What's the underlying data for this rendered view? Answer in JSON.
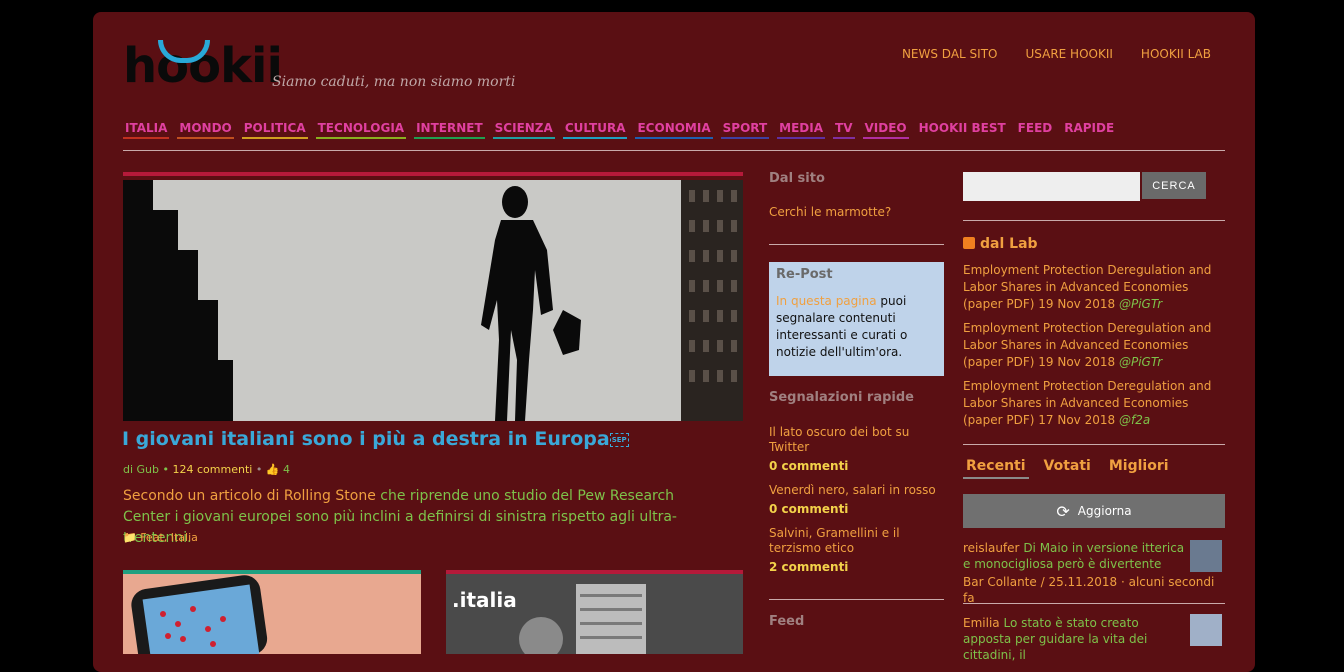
{
  "header": {
    "logo": "hookii",
    "tagline": "Siamo caduti, ma non siamo morti",
    "topnav": [
      "NEWS DAL SITO",
      "USARE HOOKII",
      "HOOKII LAB"
    ]
  },
  "categories": [
    {
      "label": "ITALIA",
      "color": "#e040a0",
      "line": "#c03020"
    },
    {
      "label": "MONDO",
      "color": "#e040a0",
      "line": "#c05020"
    },
    {
      "label": "POLITICA",
      "color": "#e040a0",
      "line": "#d0a020"
    },
    {
      "label": "TECNOLOGIA",
      "color": "#e040a0",
      "line": "#8ab020"
    },
    {
      "label": "INTERNET",
      "color": "#e040a0",
      "line": "#20a050"
    },
    {
      "label": "SCIENZA",
      "color": "#e040a0",
      "line": "#20a0a0"
    },
    {
      "label": "CULTURA",
      "color": "#e040a0",
      "line": "#20a0c0"
    },
    {
      "label": "ECONOMIA",
      "color": "#e040a0",
      "line": "#2060b0"
    },
    {
      "label": "SPORT",
      "color": "#e040a0",
      "line": "#4040a0"
    },
    {
      "label": "MEDIA",
      "color": "#e040a0",
      "line": "#6030a0"
    },
    {
      "label": "TV",
      "color": "#e040a0",
      "line": "#8030a0"
    },
    {
      "label": "VIDEO",
      "color": "#e040a0",
      "line": "#b030a0"
    },
    {
      "label": "HOOKII BEST",
      "color": "#e040a0",
      "line": "#5a0f13"
    },
    {
      "label": "FEED",
      "color": "#e040a0",
      "line": "#5a0f13"
    },
    {
      "label": "RAPIDE",
      "color": "#e040a0",
      "line": "#5a0f13"
    }
  ],
  "hero": {
    "title": "I giovani italiani sono i più a destra in Europa",
    "sep": "SEP",
    "byline_prefix": "di Gub •",
    "comments": "124 commenti",
    "likes": "4",
    "excerpt_link": "Secondo un articolo di Rolling Stone",
    "excerpt_rest": "che riprende uno studio del Pew Research Center i giovani europei sono più inclini a definirsi di sinistra rispetto agli ultra-trentenni.",
    "tags": "Feat, Italia"
  },
  "cards": [
    {
      "bar_color": "#20a080"
    },
    {
      "bar_color": "#b51a3a",
      "label": ".italia"
    }
  ],
  "mid": {
    "dal_sito_title": "Dal sito",
    "dal_sito_link": "Cerchi le marmotte?",
    "repost_title": "Re-Post",
    "repost_link": "In questa pagina",
    "repost_text": "puoi segnalare contenuti interessanti e curati o notizie dell'ultim'ora.",
    "rapide_title": "Segnalazioni rapide",
    "rapide": [
      {
        "title": "Il lato oscuro dei bot su Twitter",
        "comments": "0 commenti"
      },
      {
        "title": "Venerdì nero, salari in rosso",
        "comments": "0 commenti"
      },
      {
        "title": "Salvini, Gramellini e il terzismo etico",
        "comments": "2 commenti"
      }
    ],
    "feed_title": "Feed"
  },
  "sidebar": {
    "search_button": "CERCA",
    "lab_title": "dal Lab",
    "lab_items": [
      {
        "text": "Employment Protection Deregulation and Labor Shares in Advanced Economies (paper PDF) 19 Nov 2018",
        "author": "@PiGTr"
      },
      {
        "text": "Employment Protection Deregulation and Labor Shares in Advanced Economies (paper PDF) 19 Nov 2018",
        "author": "@PiGTr"
      },
      {
        "text": "Employment Protection Deregulation and Labor Shares in Advanced Economies (paper PDF) 17 Nov 2018",
        "author": "@f2a"
      }
    ],
    "tabs": [
      "Recenti",
      "Votati",
      "Migliori"
    ],
    "refresh_label": "Aggiorna",
    "recent": [
      {
        "user": "reislaufer",
        "text": "Di Maio in versione itterica e monocigliosa però è divertente",
        "meta": "Bar Collante / 25.11.2018 · alcuni secondi fa"
      },
      {
        "user": "Emilia",
        "text": "Lo stato è stato creato apposta per guidare la vita dei cittadini, il",
        "meta": ""
      }
    ]
  }
}
